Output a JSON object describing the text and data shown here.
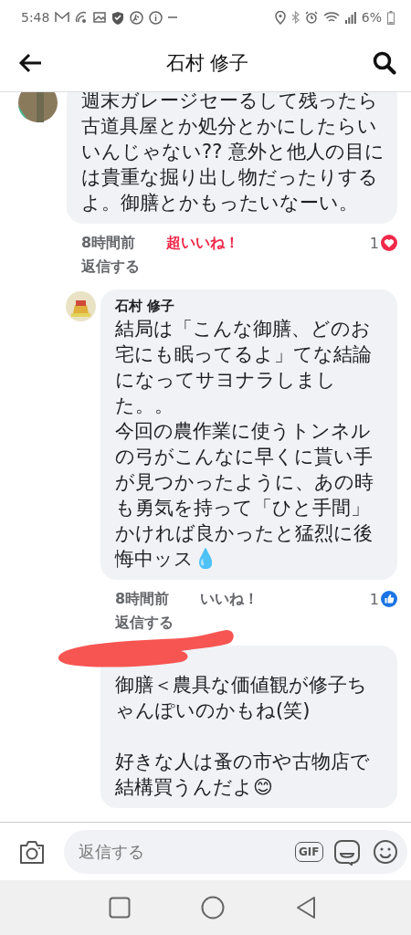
{
  "status_bar": {
    "time": "5:48",
    "battery": "6%"
  },
  "header": {
    "title": "石村 修子"
  },
  "comments": [
    {
      "paragraphs": [
        "週末ガレージセーるして残ったら古道具屋とか処分とかにしたらいいんじゃない?? 意外と他人の目には貴重な掘り出し物だったりするよ。御膳とかもったいなーい。"
      ],
      "time": "8時間前",
      "reaction": {
        "kind": "love",
        "label": "超いいね！",
        "reacted": true,
        "count": "1"
      },
      "reply_label": "返信する",
      "name_hidden": false,
      "replies": [
        {
          "author": "石村 修子",
          "paragraphs": [
            "結局は「こんな御膳、どのお宅にも眠ってるよ」てな結論になってサヨナラしました。。",
            "今回の農作業に使うトンネルの弓がこんなに早くに貰い手が見つかったように、あの時も勇気を持って「ひと手間」かければ良かったと猛烈に後悔中ッス💧"
          ],
          "time": "8時間前",
          "reaction": {
            "kind": "like",
            "label": "いいね！",
            "reacted": false,
            "count": "1"
          },
          "reply_label": "返信する",
          "name_hidden": false
        },
        {
          "paragraphs": [
            "御膳＜農具な価値観が修子ちゃんぽいのかもね(笑)",
            "好きな人は蚤の市や古物店で結構買うんだよ😊"
          ],
          "blank_lines": true,
          "name_hidden": true
        }
      ]
    }
  ],
  "composer": {
    "placeholder": "返信する",
    "gif_label": "GIF"
  }
}
